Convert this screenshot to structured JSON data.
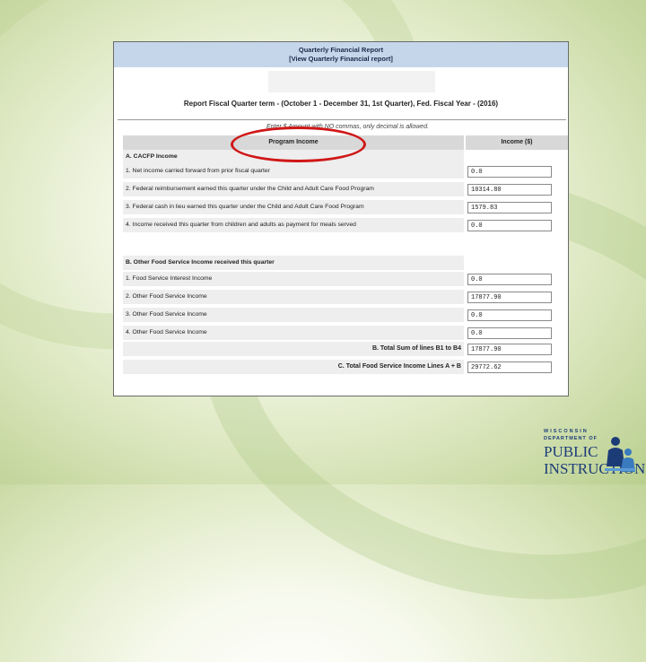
{
  "report": {
    "title": "Quarterly Financial Report",
    "subtitle": "[View Quarterly Financial report]",
    "term": "Report Fiscal Quarter term - (October 1 - December 31, 1st Quarter), Fed. Fiscal Year - (2016)",
    "note": "Enter $ Amount with NO commas, only decimal is allowed."
  },
  "table": {
    "col_income": "Program Income",
    "col_amount": "Income ($)",
    "section_a": "A. CACFP Income",
    "rows_a": [
      {
        "label": "1. Net income carried forward from prior fiscal quarter",
        "value": "0.0"
      },
      {
        "label": "2. Federal reimbursement earned this quarter under the Child and Adult Care Food Program",
        "value": "10314.80"
      },
      {
        "label": "3. Federal cash in lieu earned this quarter under the Child and Adult Care Food Program",
        "value": "1579.83"
      },
      {
        "label": "4. Income received this quarter from children and adults as payment for meals served",
        "value": "0.0"
      }
    ],
    "section_b": "B. Other Food Service Income received this quarter",
    "rows_b": [
      {
        "label": "1. Food Service Interest Income",
        "value": "0.0"
      },
      {
        "label": "2. Other Food Service Income",
        "value": "17877.90"
      },
      {
        "label": "3. Other Food Service Income",
        "value": "0.0"
      },
      {
        "label": "4. Other Food Service Income",
        "value": "0.0"
      }
    ],
    "total_b_label": "B. Total Sum of lines B1 to B4",
    "total_b_value": "17877.90",
    "total_c_label": "C. Total Food Service Income Lines A + B",
    "total_c_value": "29772.62"
  },
  "logo": {
    "line1": "WISCONSIN",
    "line2": "DEPARTMENT OF",
    "line3": "PUBLIC",
    "line4": "INSTRUCTION"
  },
  "colors": {
    "highlight": "#d01717",
    "header_band": "#c6d6ea",
    "brand": "#1c3c78"
  }
}
